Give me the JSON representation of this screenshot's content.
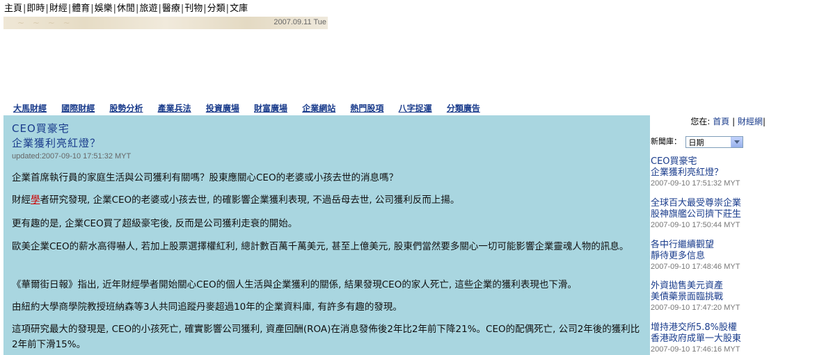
{
  "top_nav": [
    "主頁",
    "即時",
    "財經",
    "體育",
    "娛樂",
    "休閒",
    "旅遊",
    "醫療",
    "刊物",
    "分類",
    "文庫"
  ],
  "banner": {
    "date": "2007.09.11 Tue"
  },
  "section_nav": [
    "大馬財經",
    "國際財經",
    "股勢分析",
    "產業兵法",
    "投資廣場",
    "財富廣場",
    "企業網站",
    "熱門股項",
    "八字捉運",
    "分類廣告"
  ],
  "article": {
    "title_line1": "CEO買豪宅",
    "title_line2": "企業獲利亮紅燈？",
    "updated": "updated:2007-09-10 17:51:32 MYT",
    "p1": "企業首席執行員的家庭生活與公司獲利有關嗎？股東應關心CEO的老婆或小孩去世的消息嗎？",
    "p2_before": "財經",
    "p2_highlight": "學",
    "p2_after": "者研究發現, 企業CEO的老婆或小孩去世, 的確影響企業獲利表現, 不過岳母去世, 公司獲利反而上揚。",
    "p3": "更有趣的是, 企業CEO買了超級豪宅後, 反而是公司獲利走衰的開始。",
    "p4": "歐美企業CEO的薪水高得嚇人, 若加上股票選擇權紅利, 總計數百萬千萬美元, 甚至上億美元, 股東們當然要多關心一切可能影響企業靈魂人物的訊息。",
    "p5": "《華爾街日報》指出, 近年財經學者開始關心CEO的個人生活與企業獲利的關係, 結果發現CEO的家人死亡, 這些企業的獲利表現也下滑。",
    "p6": "由紐約大學商學院教授班納森等3人共同追蹤丹麥超過10年的企業資料庫, 有許多有趣的發現。",
    "p7": "這項研究最大的發現是, CEO的小孩死亡, 確實影響公司獲利, 資產回酬(ROA)在消息發佈後2年比2年前下降21%。CEO的配偶死亡, 公司2年後的獲利比2年前下滑15%。"
  },
  "sidebar": {
    "crumb_prefix": "您在:",
    "crumb_home": "首頁",
    "crumb_sep": "|",
    "crumb_section": "財經網",
    "crumb_end": "|",
    "news_db_label": "新聞庫：",
    "news_db_selected": "日期",
    "news": [
      {
        "line1": "CEO買豪宅",
        "line2": "企業獲利亮紅燈？",
        "date": "2007-09-10 17:51:32 MYT"
      },
      {
        "line1": "全球百大最受尊崇企業",
        "line2": "股神旗艦公司擠下莊生",
        "date": "2007-09-10 17:50:44 MYT"
      },
      {
        "line1": "各中行繼續觀望",
        "line2": "靜待更多信息",
        "date": "2007-09-10 17:48:46 MYT"
      },
      {
        "line1": "外資拋售美元資產",
        "line2": "美債藥景面臨挑戰",
        "date": "2007-09-10 17:47:20 MYT"
      },
      {
        "line1": "增持港交所5.8%股權",
        "line2": "香港政府成單一大股東",
        "date": "2007-09-10 17:46:16 MYT"
      }
    ]
  }
}
